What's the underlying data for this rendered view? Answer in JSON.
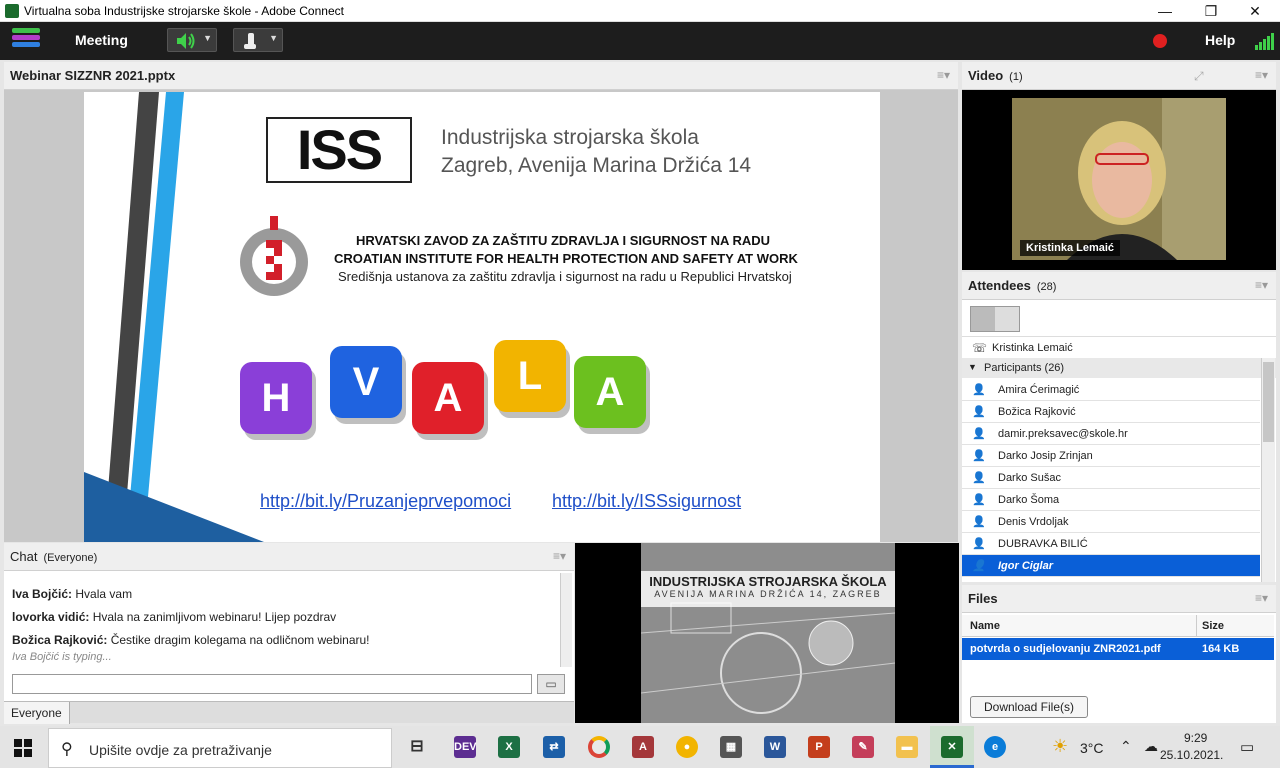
{
  "window": {
    "title": "Virtualna soba Industrijske strojarske škole - Adobe Connect",
    "minimize": "—",
    "maximize": "❐",
    "close": "✕"
  },
  "menubar": {
    "meeting": "Meeting",
    "help": "Help"
  },
  "share_pod": {
    "title": "Webinar SIZZNR 2021.pptx",
    "slide": {
      "logo_text": "ISS",
      "school_line1": "Industrijska strojarska škola",
      "school_line2": "Zagreb, Avenija Marina Držića 14",
      "inst_line1": "HRVATSKI ZAVOD ZA ZAŠTITU ZDRAVLJA I SIGURNOST NA RADU",
      "inst_line2": "CROATIAN INSTITUTE FOR HEALTH PROTECTION AND SAFETY AT WORK",
      "inst_line3": "Središnja ustanova za zaštitu zdravlja i sigurnost na radu u Republici Hrvatskoj",
      "cubes": [
        "H",
        "V",
        "A",
        "L",
        "A"
      ],
      "link1": "http://bit.ly/Pruzanjeprvepomoci",
      "link2": "http://bit.ly/ISSsigurnost"
    }
  },
  "video_pod": {
    "title": "Video",
    "count": "(1)",
    "caption": "Kristinka Lemaić"
  },
  "attendees_pod": {
    "title": "Attendees",
    "count": "(28)",
    "host": "Kristinka Lemaić",
    "participants_header": "Participants (26)",
    "participants": [
      "Amira Ćerimagić",
      "Božica Rajković",
      "damir.preksavec@skole.hr",
      "Darko Josip Zrinjan",
      "Darko Sušac",
      "Darko Šoma",
      "Denis Vrdoljak",
      "DUBRAVKA BILIĆ",
      "Igor Ciglar"
    ]
  },
  "chat_pod": {
    "title": "Chat",
    "audience": "(Everyone)",
    "messages": [
      {
        "sender": "Iva Bojčić:",
        "text": "Hvala vam"
      },
      {
        "sender": "lovorka vidić:",
        "text": "Hvala na zanimljivom webinaru! Lijep pozdrav"
      },
      {
        "sender": "Božica Rajković:",
        "text": "Čestike dragim kolegama na odličnom webinaru!"
      }
    ],
    "typing": "Iva Bojčić is typing...",
    "recipient": "Everyone"
  },
  "banner": {
    "line1": "INDUSTRIJSKA STROJARSKA ŠKOLA",
    "line2": "AVENIJA MARINA DRŽIĆA 14, ZAGREB"
  },
  "files_pod": {
    "title": "Files",
    "col_name": "Name",
    "col_size": "Size",
    "file_name": "potvrda o sudjelovanju ZNR2021.pdf",
    "file_size": "164 KB",
    "download": "Download File(s)"
  },
  "taskbar": {
    "search_placeholder": "Upišite ovdje za pretraživanje",
    "temperature": "3°C",
    "time": "9:29",
    "date": "25.10.2021."
  }
}
